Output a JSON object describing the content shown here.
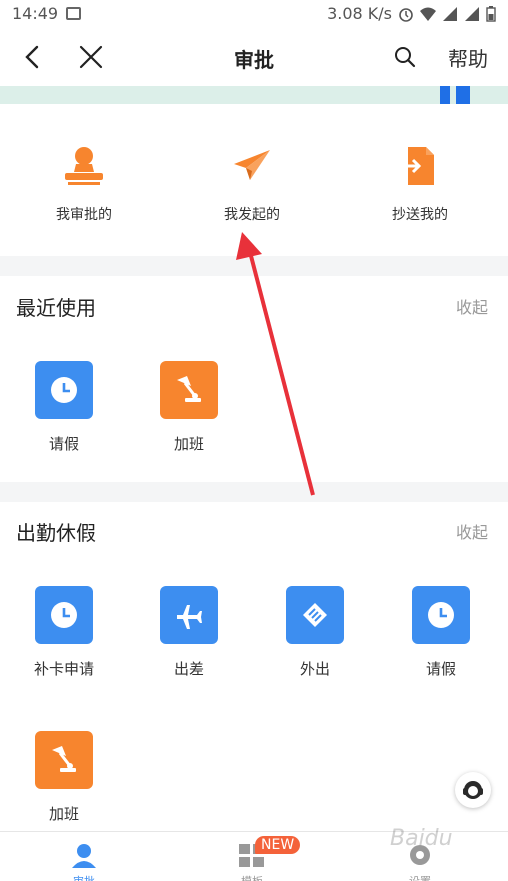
{
  "status_bar": {
    "time": "14:49",
    "speed": "3.08 K/s"
  },
  "header": {
    "title": "审批",
    "help_label": "帮助"
  },
  "top_entries": [
    {
      "label": "我审批的",
      "icon": "stamp-icon"
    },
    {
      "label": "我发起的",
      "icon": "paper-plane-icon"
    },
    {
      "label": "抄送我的",
      "icon": "document-import-icon"
    }
  ],
  "recent": {
    "title": "最近使用",
    "collapse_label": "收起",
    "apps": [
      {
        "label": "请假",
        "icon": "clock-icon",
        "color": "#3d8ef0"
      },
      {
        "label": "加班",
        "icon": "desk-lamp-icon",
        "color": "#f7852e"
      }
    ]
  },
  "attendance": {
    "title": "出勤休假",
    "collapse_label": "收起",
    "apps": [
      {
        "label": "补卡申请",
        "icon": "clock-icon",
        "color": "#3d8ef0"
      },
      {
        "label": "出差",
        "icon": "airplane-icon",
        "color": "#3d8ef0"
      },
      {
        "label": "外出",
        "icon": "handshake-icon",
        "color": "#3d8ef0"
      },
      {
        "label": "请假",
        "icon": "clock-icon",
        "color": "#3d8ef0"
      },
      {
        "label": "加班",
        "icon": "desk-lamp-icon",
        "color": "#f7852e"
      }
    ]
  },
  "bottom_nav": [
    {
      "label": "审批",
      "active": true
    },
    {
      "label": "模板",
      "active": false
    },
    {
      "label": "设置",
      "active": false
    }
  ],
  "new_badge": "NEW",
  "watermark": "Baidu",
  "colors": {
    "accent_blue": "#3d8ef0",
    "accent_orange": "#f7852e",
    "annotation_red": "#e8313a"
  }
}
